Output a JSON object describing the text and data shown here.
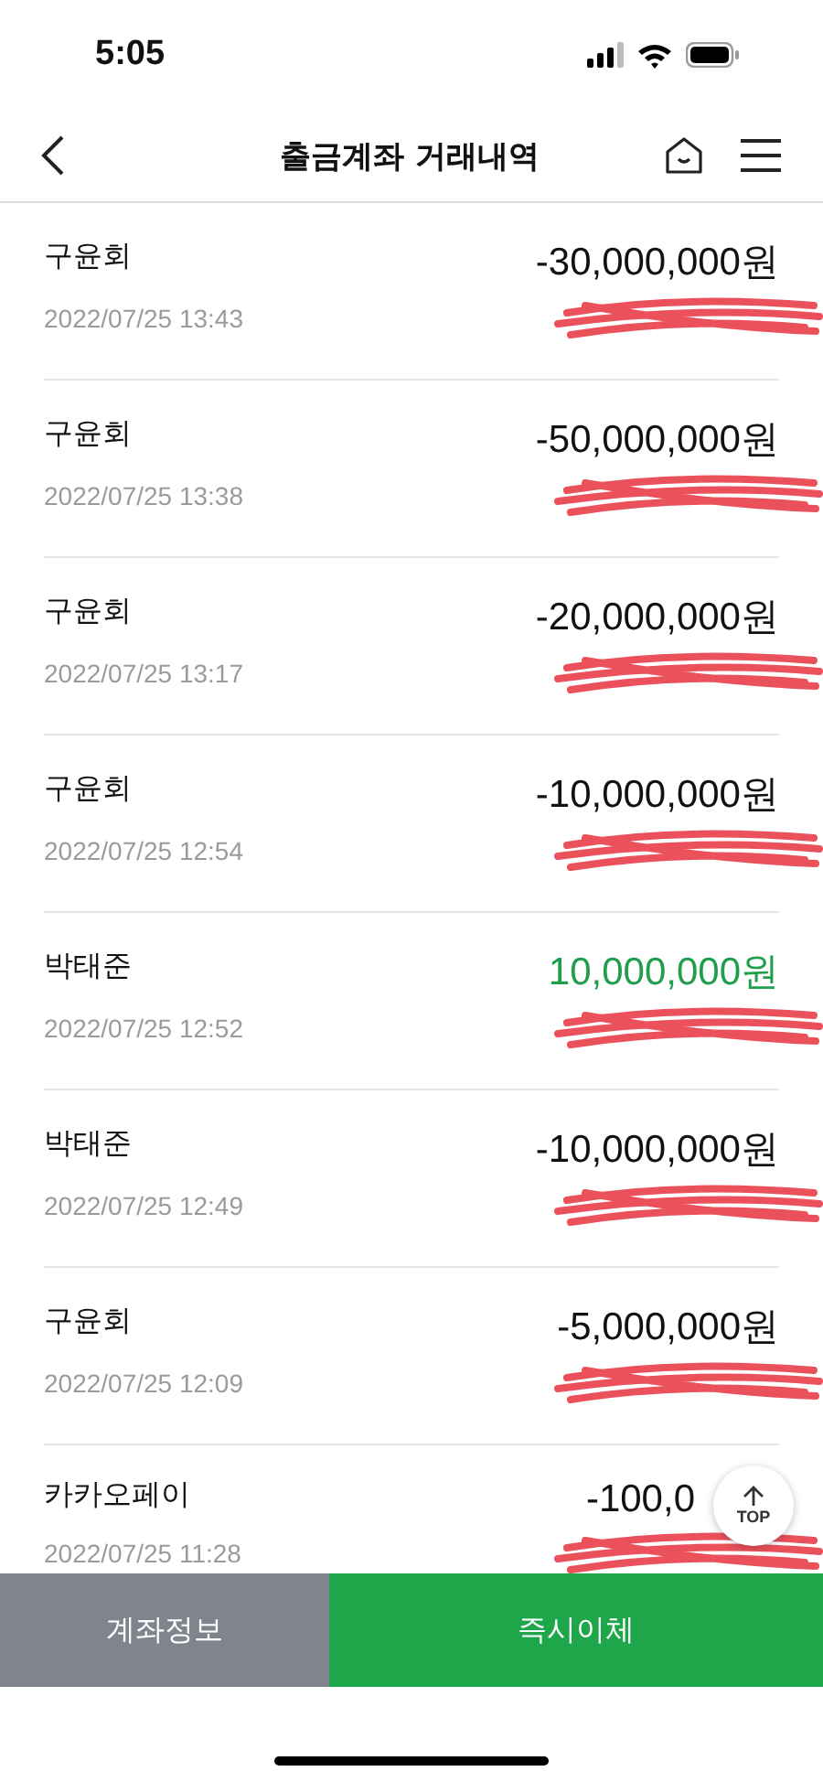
{
  "status_bar": {
    "time": "5:05"
  },
  "header": {
    "title": "출금계좌 거래내역"
  },
  "transactions": [
    {
      "name": "구윤회",
      "date": "2022/07/25 13:43",
      "amount": "-30,000,000원",
      "incoming": false
    },
    {
      "name": "구윤회",
      "date": "2022/07/25 13:38",
      "amount": "-50,000,000원",
      "incoming": false
    },
    {
      "name": "구윤회",
      "date": "2022/07/25 13:17",
      "amount": "-20,000,000원",
      "incoming": false
    },
    {
      "name": "구윤회",
      "date": "2022/07/25 12:54",
      "amount": "-10,000,000원",
      "incoming": false
    },
    {
      "name": "박태준",
      "date": "2022/07/25 12:52",
      "amount": "10,000,000원",
      "incoming": true
    },
    {
      "name": "박태준",
      "date": "2022/07/25 12:49",
      "amount": "-10,000,000원",
      "incoming": false
    },
    {
      "name": "구윤회",
      "date": "2022/07/25 12:09",
      "amount": "-5,000,000원",
      "incoming": false
    },
    {
      "name": "카카오페이",
      "date": "2022/07/25 11:28",
      "amount": "-100,0",
      "incoming": false
    }
  ],
  "top_button": {
    "label": "TOP"
  },
  "bottom_bar": {
    "buttons": [
      {
        "label": "계좌정보",
        "kind": "secondary"
      },
      {
        "label": "즉시이체",
        "kind": "primary"
      }
    ]
  }
}
